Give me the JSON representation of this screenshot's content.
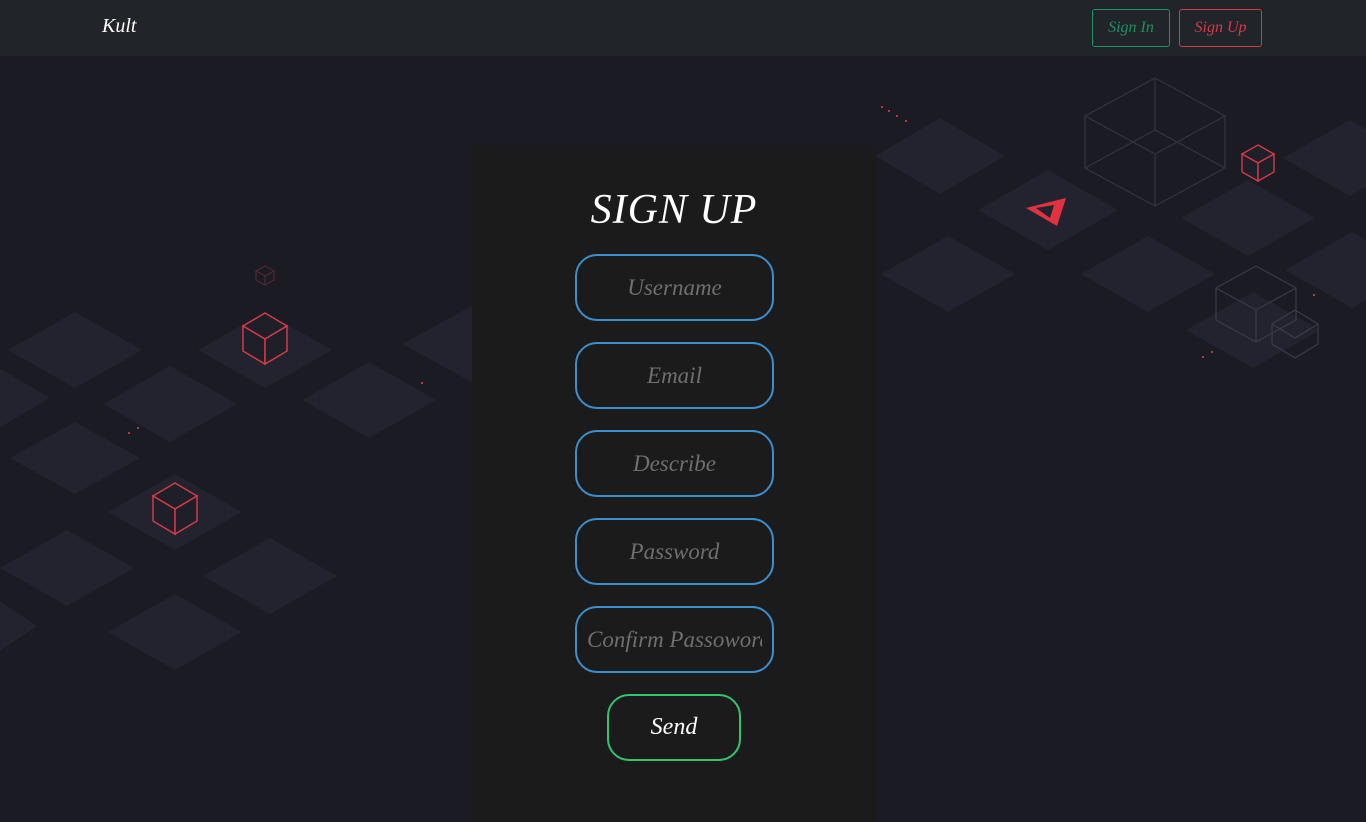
{
  "nav": {
    "brand": "Kult",
    "signin_label": "Sign In",
    "signup_label": "Sign Up"
  },
  "form": {
    "title": "SIGN UP",
    "fields": [
      {
        "placeholder": "Username",
        "value": ""
      },
      {
        "placeholder": "Email",
        "value": ""
      },
      {
        "placeholder": "Describe",
        "value": ""
      },
      {
        "placeholder": "Password",
        "value": ""
      },
      {
        "placeholder": "Confirm Passoword",
        "value": ""
      }
    ],
    "submit_label": "Send"
  },
  "colors": {
    "background": "#1b1b24",
    "navbar": "#212429",
    "panel": "#1b1b1b",
    "field_border": "#3a8fd1",
    "send_border": "#33c46e",
    "signin_accent": "#1f9160",
    "signup_accent": "#d23a47",
    "tile": "#22232f",
    "cube_red": "#d23a47"
  },
  "background_icons": [
    "isometric-tile",
    "cube-icon",
    "arrow-logo-icon",
    "wireframe-cube-icon"
  ]
}
